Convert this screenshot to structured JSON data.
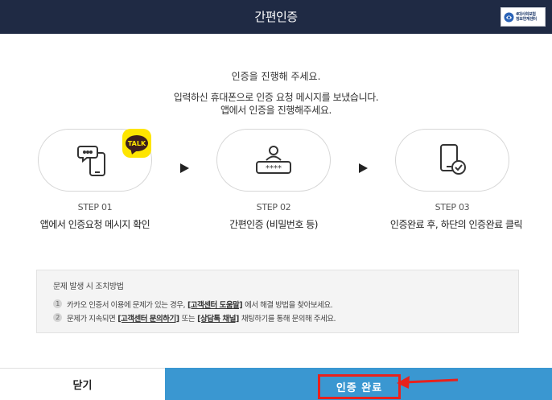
{
  "header": {
    "title": "간편인증",
    "logo_line1": "4대사회보험",
    "logo_line2": "정보연계센터"
  },
  "intro": {
    "heading": "인증을 진행해 주세요.",
    "line1": "입력하신 휴대폰으로 인증 요청 메시지를 보냈습니다.",
    "line2": "앱에서 인증을 진행해주세요."
  },
  "steps": [
    {
      "label": "STEP 01",
      "desc": "앱에서 인증요청 메시지 확인",
      "icon": "phone-chat-icon"
    },
    {
      "label": "STEP 02",
      "desc": "간편인증 (비밀번호 등)",
      "icon": "user-password-icon"
    },
    {
      "label": "STEP 03",
      "desc": "인증완료 후, 하단의 인증완료 클릭",
      "icon": "phone-check-icon"
    }
  ],
  "kakao_badge": {
    "text": "TALK",
    "color": "#fee500"
  },
  "notice": {
    "title": "문제 발생 시 조치방법",
    "items": [
      {
        "num": "1",
        "before": "카카오 인증서 이용에 문제가 있는 경우,",
        "link": "[고객센터 도움말]",
        "after": "에서 해결 방법을 찾아보세요."
      },
      {
        "num": "2",
        "before": "문제가 지속되면",
        "link": "[고객센터 문의하기]",
        "middle": "또는",
        "link2": "[상담톡 채널]",
        "after": "채팅하기를 통해 문의해 주세요."
      }
    ]
  },
  "footer": {
    "close_label": "닫기",
    "done_label": "인증 완료"
  },
  "colors": {
    "header_bg": "#1f2a44",
    "done_bg": "#3a97d1",
    "highlight": "#e8211c"
  }
}
